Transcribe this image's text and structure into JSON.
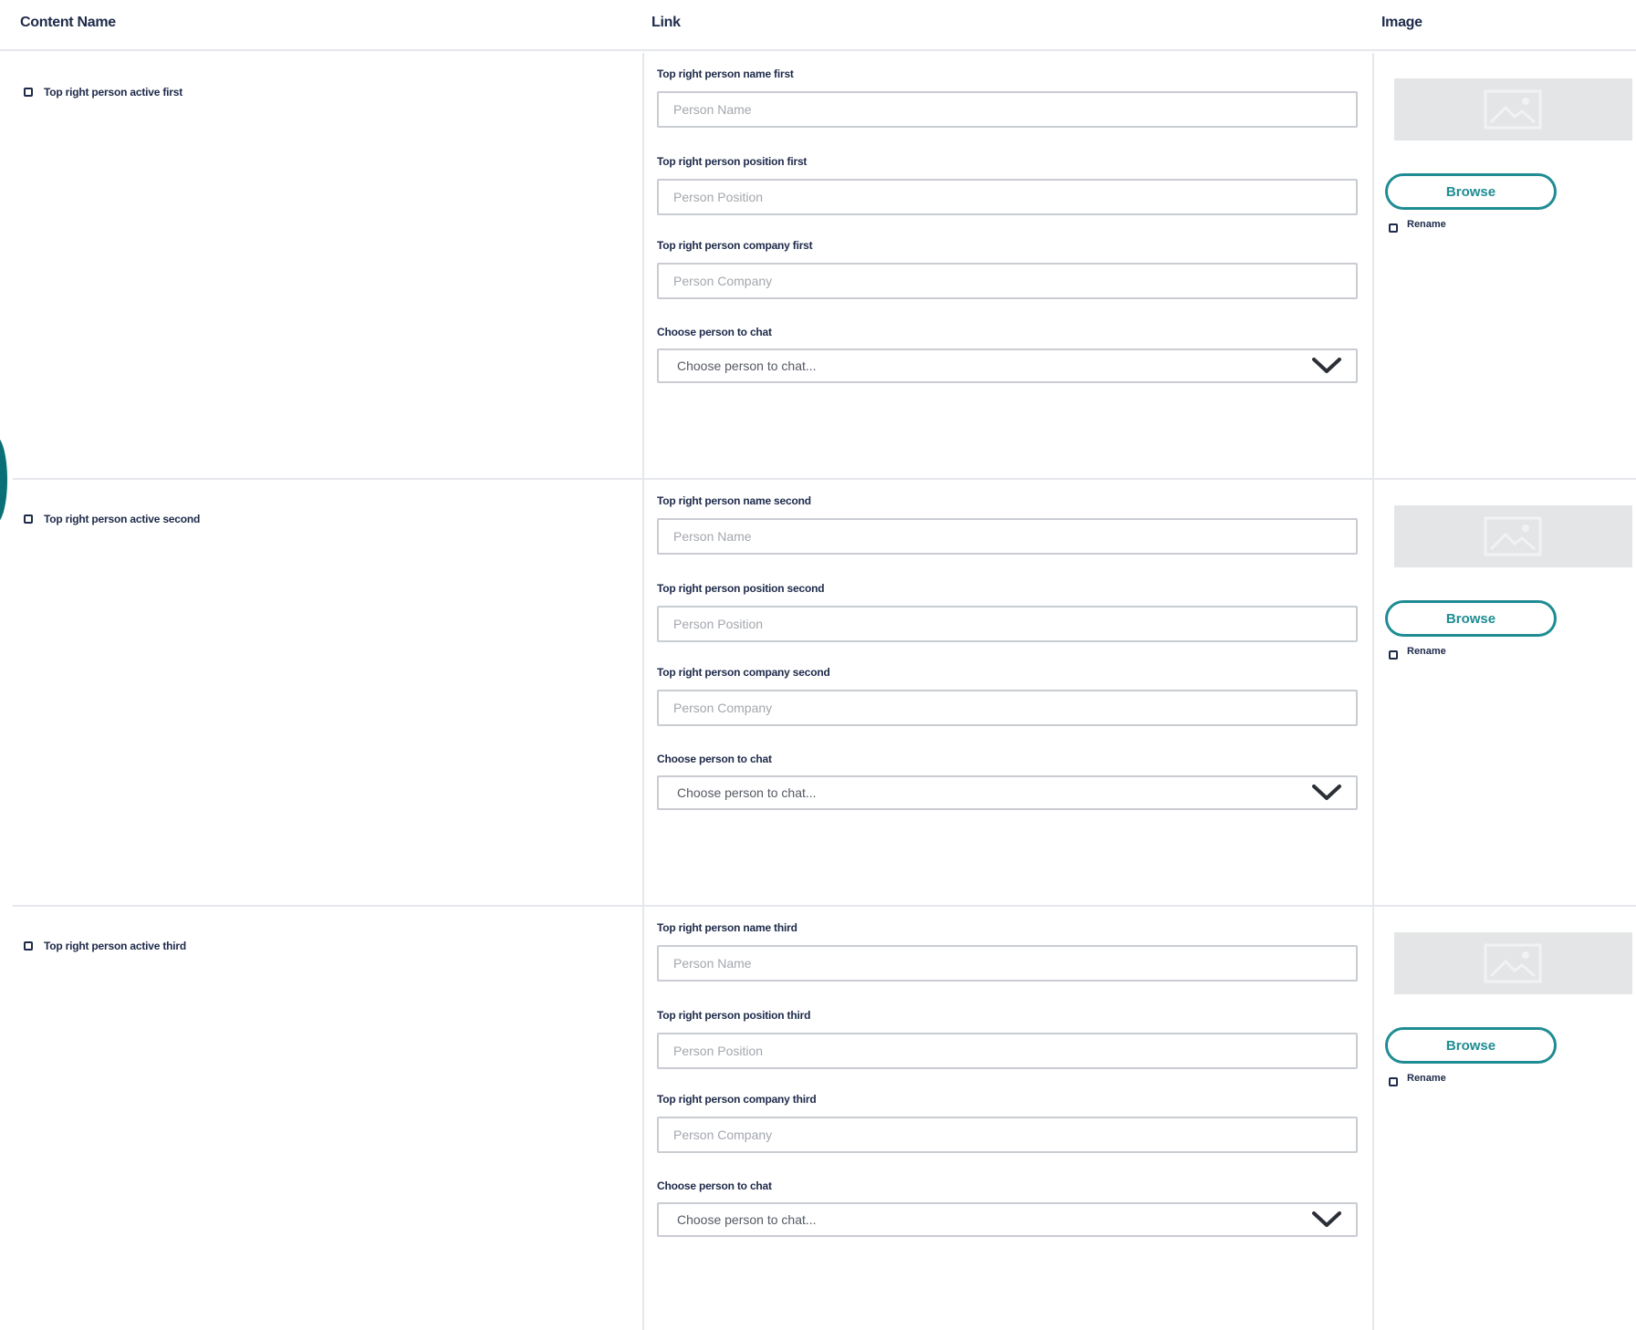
{
  "header": {
    "content_name": "Content Name",
    "link": "Link",
    "image": "Image"
  },
  "rows": [
    {
      "active_label": "Top right person active first",
      "name_label": "Top right person name first",
      "name_placeholder": "Person Name",
      "position_label": "Top right person position first",
      "position_placeholder": "Person Position",
      "company_label": "Top right person company first",
      "company_placeholder": "Person Company",
      "chat_label": "Choose person to chat",
      "chat_value": "Choose person to chat...",
      "browse_label": "Browse",
      "rename_label": "Rename"
    },
    {
      "active_label": "Top right person active second",
      "name_label": "Top right person name second",
      "name_placeholder": "Person Name",
      "position_label": "Top right person position second",
      "position_placeholder": "Person Position",
      "company_label": "Top right person company second",
      "company_placeholder": "Person Company",
      "chat_label": "Choose person to chat",
      "chat_value": "Choose person to chat...",
      "browse_label": "Browse",
      "rename_label": "Rename"
    },
    {
      "active_label": "Top right person active third",
      "name_label": "Top right person name third",
      "name_placeholder": "Person Name",
      "position_label": "Top right person position third",
      "position_placeholder": "Person Position",
      "company_label": "Top right person company third",
      "company_placeholder": "Person Company",
      "chat_label": "Choose person to chat",
      "chat_value": "Choose person to chat...",
      "browse_label": "Browse",
      "rename_label": "Rename"
    }
  ],
  "icons": {
    "image_placeholder": "image-icon",
    "dropdown": "chevron-down-icon"
  },
  "colors": {
    "accent": "#1f8c93",
    "text": "#1e2a4a",
    "divider": "#e4e7ec",
    "placeholder_bg": "#e4e5e6"
  }
}
